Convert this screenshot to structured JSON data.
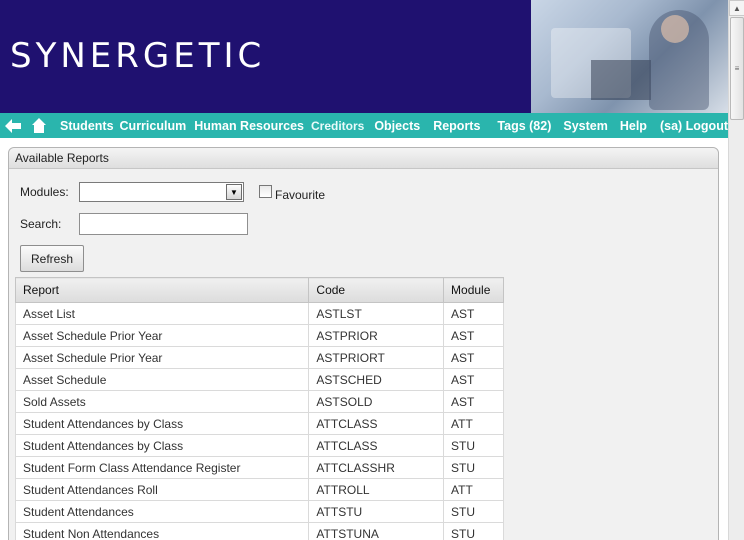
{
  "banner": {
    "logo": "SYNERGETIC"
  },
  "nav": {
    "items": [
      {
        "label": "Students",
        "name": "nav-students"
      },
      {
        "label": "Curriculum",
        "name": "nav-curriculum"
      },
      {
        "label": "Human Resources",
        "name": "nav-human-resources"
      },
      {
        "label": "Creditors",
        "name": "nav-creditors"
      },
      {
        "label": "Objects",
        "name": "nav-objects"
      },
      {
        "label": "Reports",
        "name": "nav-reports"
      },
      {
        "label": "Tags (82)",
        "name": "nav-tags"
      },
      {
        "label": "System",
        "name": "nav-system"
      },
      {
        "label": "Help",
        "name": "nav-help"
      },
      {
        "label": "(sa) Logout",
        "name": "nav-logout"
      }
    ]
  },
  "panel": {
    "title": "Available Reports",
    "modules_label": "Modules:",
    "modules_value": "",
    "favourite_label": "Favourite",
    "favourite_checked": false,
    "search_label": "Search:",
    "search_value": "",
    "refresh_label": "Refresh"
  },
  "table": {
    "headers": [
      "Report",
      "Code",
      "Module"
    ],
    "rows": [
      [
        "Asset List",
        "ASTLST",
        "AST"
      ],
      [
        "Asset Schedule Prior Year",
        "ASTPRIOR",
        "AST"
      ],
      [
        "Asset Schedule Prior Year",
        "ASTPRIORT",
        "AST"
      ],
      [
        "Asset Schedule",
        "ASTSCHED",
        "AST"
      ],
      [
        "Sold Assets",
        "ASTSOLD",
        "AST"
      ],
      [
        "Student Attendances by Class",
        "ATTCLASS",
        "ATT"
      ],
      [
        "Student Attendances by Class",
        "ATTCLASS",
        "STU"
      ],
      [
        "Student Form Class Attendance Register",
        "ATTCLASSHR",
        "STU"
      ],
      [
        "Student Attendances Roll",
        "ATTROLL",
        "ATT"
      ],
      [
        "Student Attendances",
        "ATTSTU",
        "STU"
      ],
      [
        "Student Non Attendances",
        "ATTSTUNA",
        "STU"
      ]
    ]
  },
  "colors": {
    "banner_bg": "#1f1170",
    "nav_bg": "#2ab5ad",
    "panel_bg": "#f1f1f1"
  },
  "icons": {
    "back": "back-arrow-icon",
    "home": "home-icon"
  }
}
